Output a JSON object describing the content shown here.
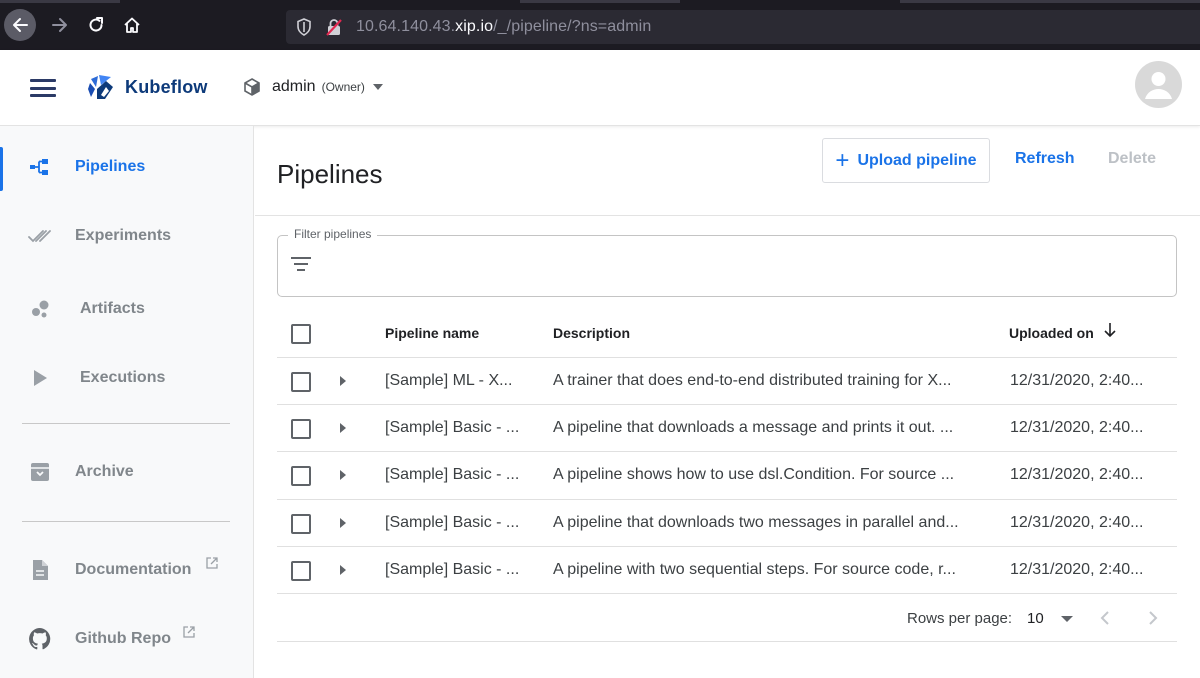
{
  "browser": {
    "url_prefix": "10.64.140.43.",
    "url_host": "xip.io",
    "url_path": "/_/pipeline/?ns=admin"
  },
  "header": {
    "app_name": "Kubeflow",
    "namespace": "admin",
    "namespace_role": "(Owner)"
  },
  "sidebar": {
    "items": [
      {
        "label": "Pipelines",
        "icon": "pipelines-icon",
        "active": true
      },
      {
        "label": "Experiments",
        "icon": "experiments-icon"
      },
      {
        "label": "Artifacts",
        "icon": "artifacts-icon"
      },
      {
        "label": "Executions",
        "icon": "play-icon"
      },
      {
        "label": "Archive",
        "icon": "archive-icon"
      },
      {
        "label": "Documentation",
        "icon": "document-icon"
      },
      {
        "label": "Github Repo",
        "icon": "github-icon"
      }
    ]
  },
  "main": {
    "title": "Pipelines",
    "upload_label": "Upload pipeline",
    "refresh_label": "Refresh",
    "delete_label": "Delete",
    "filter_label": "Filter pipelines"
  },
  "table": {
    "columns": [
      "Pipeline name",
      "Description",
      "Uploaded on"
    ],
    "rows": [
      {
        "name": "[Sample] ML - X...",
        "description": "A trainer that does end-to-end distributed training for X...",
        "uploaded": "12/31/2020, 2:40..."
      },
      {
        "name": "[Sample] Basic - ...",
        "description": "A pipeline that downloads a message and prints it out. ...",
        "uploaded": "12/31/2020, 2:40..."
      },
      {
        "name": "[Sample] Basic - ...",
        "description": "A pipeline shows how to use dsl.Condition. For source ...",
        "uploaded": "12/31/2020, 2:40..."
      },
      {
        "name": "[Sample] Basic - ...",
        "description": "A pipeline that downloads two messages in parallel and...",
        "uploaded": "12/31/2020, 2:40..."
      },
      {
        "name": "[Sample] Basic - ...",
        "description": "A pipeline with two sequential steps. For source code, r...",
        "uploaded": "12/31/2020, 2:40..."
      }
    ]
  },
  "pagination": {
    "rows_per_page_label": "Rows per page:",
    "rows_per_page": "10"
  },
  "colors": {
    "accent": "#1a73e8",
    "brand": "#0d3a7a",
    "browser_chrome": "#1c1b22"
  }
}
